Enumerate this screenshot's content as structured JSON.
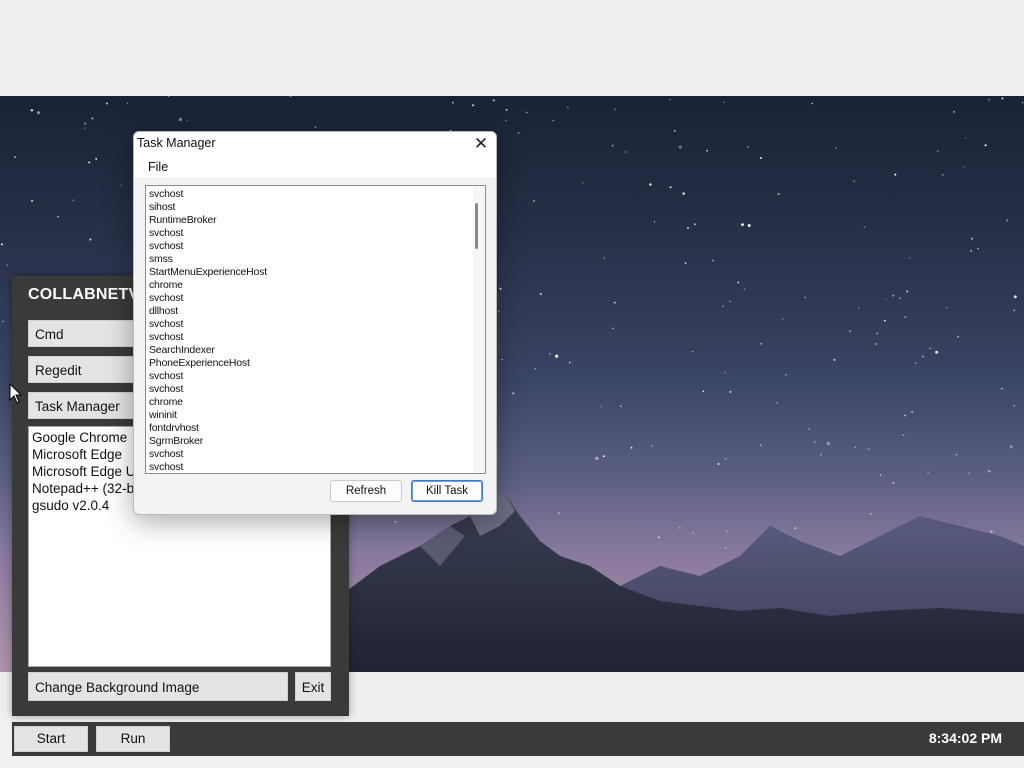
{
  "launcher": {
    "title": "COLLABNETVM",
    "buttons": [
      {
        "label": "Cmd"
      },
      {
        "label": "Regedit"
      },
      {
        "label": "Task Manager"
      }
    ],
    "apps": [
      "Google Chrome",
      "Microsoft Edge",
      "Microsoft Edge Update",
      "Notepad++ (32-bit x86)",
      "gsudo v2.0.4"
    ],
    "change_bg_label": "Change Background Image",
    "exit_label": "Exit"
  },
  "taskbar": {
    "start_label": "Start",
    "run_label": "Run",
    "clock": "8:34:02 PM"
  },
  "task_manager": {
    "title": "Task Manager",
    "menu": {
      "file": "File"
    },
    "processes": [
      "svchost",
      "sihost",
      "RuntimeBroker",
      "svchost",
      "svchost",
      "smss",
      "StartMenuExperienceHost",
      "chrome",
      "svchost",
      "dllhost",
      "svchost",
      "svchost",
      "SearchIndexer",
      "PhoneExperienceHost",
      "svchost",
      "svchost",
      "chrome",
      "wininit",
      "fontdrvhost",
      "SgrmBroker",
      "svchost",
      "svchost"
    ],
    "refresh_label": "Refresh",
    "kill_label": "Kill Task"
  },
  "icons": {
    "close": "close-icon",
    "cursor": "mouse-cursor-icon"
  },
  "colors": {
    "panel": "#3a3a3a",
    "accent": "#3a78c8"
  }
}
